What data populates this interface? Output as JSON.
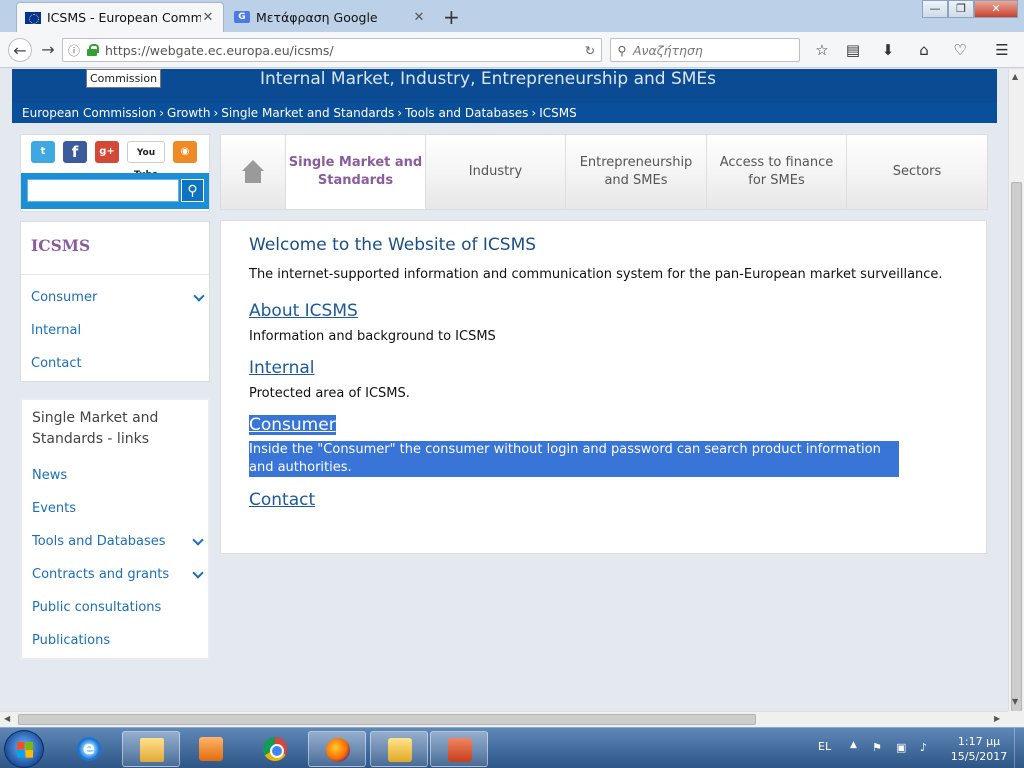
{
  "browser": {
    "tabs": [
      {
        "title": "ICSMS - European Commissi",
        "active": true
      },
      {
        "title": "Μετάφραση Google",
        "active": false
      }
    ],
    "url": "https://webgate.ec.europa.eu/icsms/",
    "search_placeholder": "Αναζήτηση"
  },
  "site": {
    "dg_title": "Internal Market, Industry, Entrepreneurship and SMEs",
    "tooltip": "Commission",
    "breadcrumb": [
      "European Commission",
      "Growth",
      "Single Market and Standards",
      "Tools and Databases",
      "ICSMS"
    ],
    "breadcrumb_sep": "›",
    "social": {
      "youtube": "You Tube"
    }
  },
  "sidebar": {
    "title": "ICSMS",
    "items": [
      "Consumer",
      "Internal",
      "Contact"
    ],
    "links_title": "Single Market and Standards - links",
    "links": [
      "News",
      "Events",
      "Tools and Databases",
      "Contracts and grants",
      "Public consultations",
      "Publications"
    ]
  },
  "mainnav": {
    "items": [
      "Single Market and Standards",
      "Industry",
      "Entrepreneurship and SMEs",
      "Access to finance for SMEs",
      "Sectors"
    ],
    "active_index": 0
  },
  "content": {
    "title": "Welcome to the Website of ICSMS",
    "intro": "The internet-supported information and communication system for the pan-European market surveillance.",
    "sections": [
      {
        "heading": "About ICSMS",
        "text": "Information and background to ICSMS"
      },
      {
        "heading": "Internal",
        "text": "Protected area of ICSMS."
      },
      {
        "heading": "Consumer",
        "text": "Inside the \"Consumer\" the consumer without login and password can search product information and authorities."
      },
      {
        "heading": "Contact",
        "text": ""
      }
    ]
  },
  "taskbar": {
    "language": "EL",
    "time": "1:17 μμ",
    "date": "15/5/2017"
  },
  "colors": {
    "banner": "#0b4b93",
    "link": "#1a6fb8",
    "active_nav": "#8a5c9e",
    "selection": "#3875d7"
  }
}
